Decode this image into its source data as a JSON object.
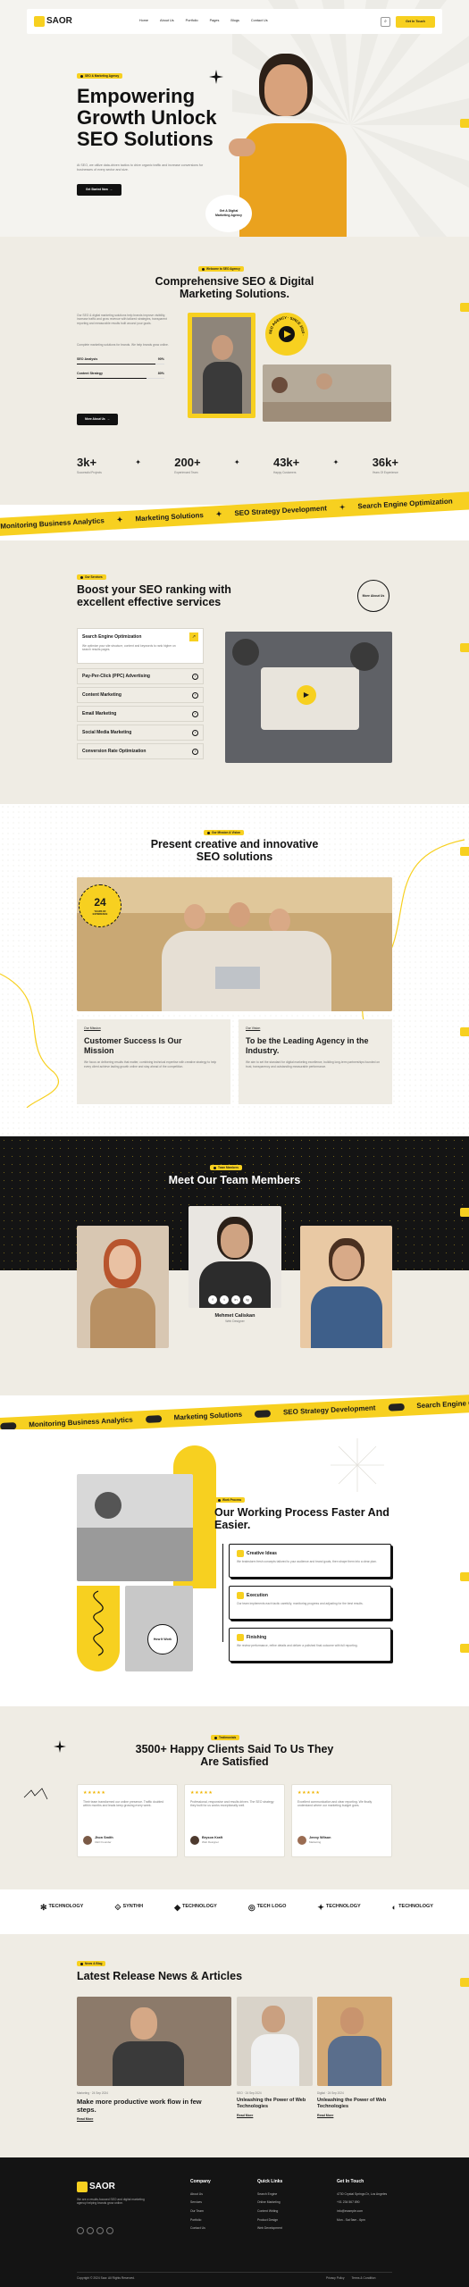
{
  "colors": {
    "accent": "#f7d020",
    "dark": "#111111",
    "cream": "#efece4"
  },
  "header": {
    "logo": "SAOR",
    "nav": [
      "Home",
      "About Us",
      "Portfolio",
      "Pages",
      "Blogs",
      "Contact Us"
    ],
    "cta": "Get In Touch"
  },
  "hero": {
    "tag": "SEO & Marketing Agency",
    "title_lines": [
      "Empowering",
      "Growth Unlock",
      "SEO Solutions"
    ],
    "desc": "At SEO, we utilize data-driven tactics to drive organic traffic and increase conversions for businesses of every sector and size.",
    "button": "Get Started Now",
    "badge_title": "Get A Digital",
    "badge_sub": "Marketing Agency"
  },
  "about": {
    "tag": "Welcome to SEO Agency",
    "title": "Comprehensive SEO & Digital Marketing Solutions.",
    "desc": "Our SEO & digital marketing solutions help brands improve visibility, increase traffic and grow revenue with tailored strategies, transparent reporting and measurable results built around your goals.",
    "desc2": "Complete marketing solutions for brands. We help brands grow online.",
    "bars": [
      {
        "label": "SEO Analysis",
        "value": "90%",
        "pct": 90
      },
      {
        "label": "Content Strategy",
        "value": "80%",
        "pct": 80
      }
    ],
    "button": "More About Us",
    "stamp": "SEO AGENCY · SINCE 2010 ·"
  },
  "stats": [
    {
      "value": "3k+",
      "label": "Successful Projects"
    },
    {
      "value": "200+",
      "label": "Experienced Team"
    },
    {
      "value": "43k+",
      "label": "Happy Customers"
    },
    {
      "value": "36k+",
      "label": "Years Of Experience"
    }
  ],
  "ticker1": [
    "Monitoring Business Analytics",
    "Marketing Solutions",
    "SEO Strategy Development",
    "Search Engine Optimization"
  ],
  "services": {
    "tag": "Our Services",
    "title": "Boost your SEO ranking with excellent effective services",
    "more": "More About Us",
    "active_desc": "We optimize your site structure, content and keywords to rank higher on search results pages.",
    "items": [
      "Search Engine Optimization",
      "Pay-Per-Click (PPC) Advertising",
      "Content Marketing",
      "Email Marketing",
      "Social Media Marketing",
      "Conversion Rate Optimization"
    ]
  },
  "mission": {
    "tag": "Our Mission & Vision",
    "title": "Present creative and innovative SEO solutions",
    "badge_num": "24",
    "badge_text": "YEARS OF EXPERIENCE",
    "cards": [
      {
        "small": "Our Mission",
        "title": "Customer Success Is Our Mission",
        "text": "We focus on delivering results that matter, combining technical expertise with creative strategy to help every client achieve lasting growth online and stay ahead of the competition."
      },
      {
        "small": "Our Vision",
        "title": "To be the Leading Agency in the Industry.",
        "text": "We aim to set the standard for digital marketing excellence, building long-term partnerships founded on trust, transparency and outstanding measurable performance."
      }
    ]
  },
  "team": {
    "tag": "Team Members",
    "title": "Meet Our Team Members",
    "featured_name": "Mehmet Caliskan",
    "featured_role": "Web Designer",
    "socials": [
      "f",
      "t",
      "in",
      "ig"
    ]
  },
  "ticker2": [
    "Monitoring Business Analytics",
    "Marketing Solutions",
    "SEO Strategy Development",
    "Search Engine Opt"
  ],
  "process": {
    "tag": "Work Process",
    "title": "Our Working Process Faster And Easier.",
    "center": "How It Work",
    "steps": [
      {
        "title": "Creative Ideas",
        "text": "We brainstorm fresh concepts tailored to your audience and brand goals, then shape them into a clear plan."
      },
      {
        "title": "Execution",
        "text": "Our team implements each tactic carefully, monitoring progress and adjusting for the best results."
      },
      {
        "title": "Finishing",
        "text": "We review performance, refine details and deliver a polished final outcome with full reporting."
      }
    ]
  },
  "testimonials": {
    "tag": "Testimonials",
    "title": "3500+ Happy Clients Said To Us They Are Satisfied",
    "items": [
      {
        "stars": "★★★★★",
        "text": "Their team transformed our online presence. Traffic doubled within months and leads keep growing every week.",
        "name": "Jhon Smith",
        "role": "CEO Founder"
      },
      {
        "stars": "★★★★★",
        "text": "Professional, responsive and results driven. The SEO strategy they built for us works exceptionally well.",
        "name": "Bryson Kraft",
        "role": "Web Designer"
      },
      {
        "stars": "★★★★★",
        "text": "Excellent communication and clear reporting. We finally understand where our marketing budget goes.",
        "name": "Jenny Wilson",
        "role": "Marketing"
      }
    ]
  },
  "logos": [
    "TECHNOLOGY",
    "SYNTHH",
    "TECHNOLOGY",
    "TECH LOGO",
    "TECHNOLOGY",
    "TECHNOLOGY"
  ],
  "blog": {
    "tag": "News & Blog",
    "title": "Latest Release News & Articles",
    "posts": [
      {
        "meta": "Marketing · 24 Sep 2024",
        "title": "Make more productive work flow in few steps.",
        "link": "Read More"
      },
      {
        "meta": "SEO · 24 Sep 2024",
        "title": "Unleashing the Power of Web Technologies",
        "link": "Read More"
      },
      {
        "meta": "Digital · 24 Sep 2024",
        "title": "Unleashing the Power of Web Technologies",
        "link": "Read More"
      }
    ]
  },
  "footer": {
    "logo": "SAOR",
    "about": "We are a results-focused SEO and digital marketing agency helping brands grow online.",
    "col1_title": "Company",
    "col1": [
      "About Us",
      "Services",
      "Our Team",
      "Portfolio",
      "Contact Us"
    ],
    "col2_title": "Quick Links",
    "col2": [
      "Search Engine",
      "Online Marketing",
      "Content Writing",
      "Product Design",
      "Web Development"
    ],
    "col3_title": "Get In Touch",
    "col3": [
      "4730 Crystal Springs Dr, Los Angeles",
      "+01 234 567 890",
      "info@example.com",
      "Mon - Sat 9am - 6pm"
    ],
    "copyright": "Copyright © 2024 Saor. All Rights Reserved.",
    "bottom_links": [
      "Privacy Policy",
      "Terms & Condition"
    ]
  }
}
